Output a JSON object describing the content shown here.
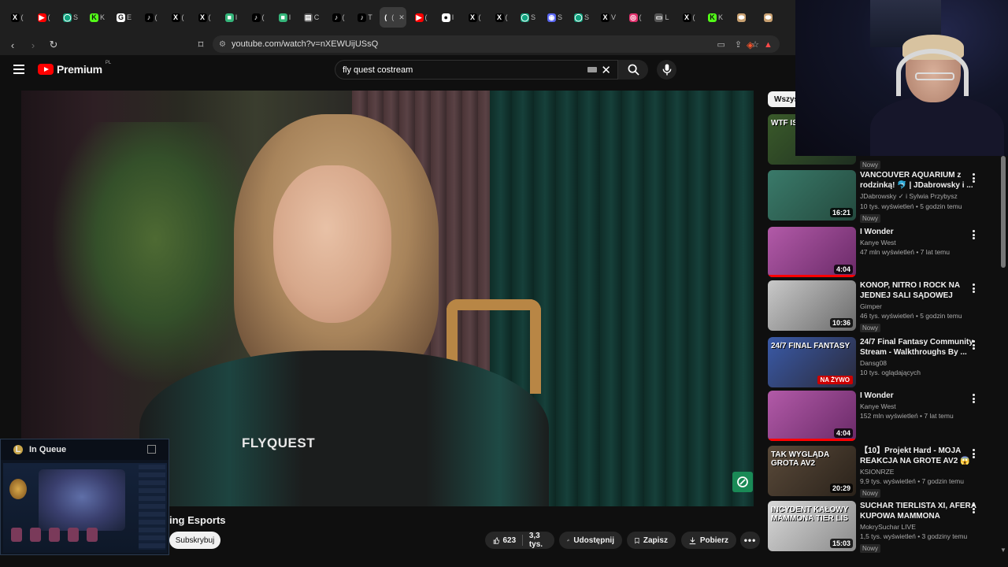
{
  "browser": {
    "tabs": [
      {
        "icon": "x-icon",
        "label": "(",
        "color": "#000000",
        "glyph": "X"
      },
      {
        "icon": "youtube-icon",
        "label": "(",
        "color": "#ff0000",
        "glyph": "▶"
      },
      {
        "icon": "circle-logo-icon",
        "label": "S",
        "color": "#10a37f",
        "glyph": "◯"
      },
      {
        "icon": "kick-icon",
        "label": "K",
        "color": "#53fc18",
        "glyph": "K"
      },
      {
        "icon": "google-icon",
        "label": "E",
        "color": "#ffffff",
        "glyph": "G"
      },
      {
        "icon": "tiktok-icon",
        "label": "(",
        "color": "#000000",
        "glyph": "♪"
      },
      {
        "icon": "x-icon",
        "label": "(",
        "color": "#000000",
        "glyph": "X"
      },
      {
        "icon": "x-icon",
        "label": "(",
        "color": "#000000",
        "glyph": "X"
      },
      {
        "icon": "app-icon",
        "label": "I",
        "color": "#35b57a",
        "glyph": "■"
      },
      {
        "icon": "tiktok-icon",
        "label": "(",
        "color": "#000000",
        "glyph": "♪"
      },
      {
        "icon": "app-icon",
        "label": "I",
        "color": "#35b57a",
        "glyph": "■"
      },
      {
        "icon": "doc-icon",
        "label": "C",
        "color": "#555555",
        "glyph": "▤"
      },
      {
        "icon": "tiktok-icon",
        "label": "(",
        "color": "#000000",
        "glyph": "♪"
      },
      {
        "icon": "tiktok-icon",
        "label": "T",
        "color": "#000000",
        "glyph": "♪"
      },
      {
        "icon": "generic-icon",
        "label": "(",
        "color": "#3c3c3c",
        "glyph": "(",
        "active": true
      },
      {
        "icon": "youtube-icon",
        "label": "(",
        "color": "#ff0000",
        "glyph": "▶"
      },
      {
        "icon": "github-icon",
        "label": "I",
        "color": "#ffffff",
        "glyph": "●"
      },
      {
        "icon": "x-icon",
        "label": "(",
        "color": "#000000",
        "glyph": "X"
      },
      {
        "icon": "x-icon",
        "label": "(",
        "color": "#000000",
        "glyph": "X"
      },
      {
        "icon": "circle-logo-icon",
        "label": "S",
        "color": "#10a37f",
        "glyph": "◯"
      },
      {
        "icon": "discord-icon",
        "label": "S",
        "color": "#5865f2",
        "glyph": "◉"
      },
      {
        "icon": "circle-logo-icon",
        "label": "S",
        "color": "#10a37f",
        "glyph": "◯"
      },
      {
        "icon": "x-icon",
        "label": "V",
        "color": "#000000",
        "glyph": "X"
      },
      {
        "icon": "instagram-icon",
        "label": "(",
        "color": "#e1306c",
        "glyph": "◎"
      },
      {
        "icon": "monitor-icon",
        "label": "L",
        "color": "#555555",
        "glyph": "▭"
      },
      {
        "icon": "x-icon",
        "label": "(",
        "color": "#000000",
        "glyph": "X"
      },
      {
        "icon": "kick-icon",
        "label": "K",
        "color": "#53fc18",
        "glyph": "K"
      },
      {
        "icon": "pill-icon",
        "label": "",
        "color": "#c8a070",
        "glyph": "⬬"
      },
      {
        "icon": "pill-icon",
        "label": "",
        "color": "#c8a070",
        "glyph": "⬬"
      }
    ],
    "close_glyph": "✕",
    "url": "youtube.com/watch?v=nXEWUijUSsQ"
  },
  "youtube": {
    "logo_text": "Premium",
    "logo_region": "PL",
    "search_value": "fly quest costream",
    "video": {
      "jacket_brand": "FLYQUEST",
      "channel_partial": "ing Esports",
      "subscribe_label": "Subskrybuj",
      "likes": "623",
      "dislikes": "3,3 tys.",
      "share_label": "Udostępnij",
      "save_label": "Zapisz",
      "download_label": "Pobierz"
    },
    "filter_chip": "Wszys",
    "related": [
      {
        "title": "",
        "channel": "",
        "stats": "",
        "badge": "Nowy",
        "duration": "",
        "thumb_colors": [
          "#3a5a2a",
          "#1e2e20"
        ],
        "thumb_text": "WTF IS THIS?!"
      },
      {
        "title": "VANCOUVER AQUARIUM z rodzinką! 🐬 | JDabrowsky i ...",
        "channel": "JDabrowsky ✓ i Sylwia Przybysz",
        "stats": "10 tys. wyświetleń • 5 godzin temu",
        "badge": "Nowy",
        "duration": "16:21",
        "thumb_colors": [
          "#3a7a6a",
          "#244a3e"
        ],
        "thumb_text": ""
      },
      {
        "title": "I Wonder",
        "channel": "Kanye West",
        "stats": "47 mln wyświetleń • 7 lat temu",
        "badge": "",
        "duration": "4:04",
        "thumb_colors": [
          "#b25aa8",
          "#6a2a68"
        ],
        "thumb_text": "",
        "progress": 1
      },
      {
        "title": "KONOP, NITRO I ROCK NA JEDNEJ SALI SĄDOWEJ",
        "channel": "Gimper",
        "stats": "46 tys. wyświetleń • 5 godzin temu",
        "badge": "Nowy",
        "duration": "10:36",
        "thumb_colors": [
          "#c9c9c9",
          "#6a6a6a"
        ],
        "thumb_text": ""
      },
      {
        "title": "24/7 Final Fantasy Community Stream - Walkthroughs By ...",
        "channel": "Dansg08",
        "stats": "10 tys. oglądających",
        "badge": "",
        "duration": "",
        "live": "NA ŻYWO",
        "thumb_colors": [
          "#3a5aa8",
          "#2a2a3a"
        ],
        "thumb_text": "24/7 FINAL FANTASY"
      },
      {
        "title": "I Wonder",
        "channel": "Kanye West",
        "stats": "152 mln wyświetleń • 7 lat temu",
        "badge": "",
        "duration": "4:04",
        "thumb_colors": [
          "#b25aa8",
          "#6a2a68"
        ],
        "thumb_text": "",
        "progress": 1
      },
      {
        "title": "【10】Projekt Hard - MOJA REAKCJA NA GROTE AV2 😱 ...",
        "channel": "KSIONRZE",
        "stats": "9,9 tys. wyświetleń • 7 godzin temu",
        "badge": "Nowy",
        "duration": "20:29",
        "thumb_colors": [
          "#5a4a3a",
          "#2a221a"
        ],
        "thumb_text": "TAK WYGLĄDA GROTA AV2"
      },
      {
        "title": "SUCHAR TIERLISTA XI, AFERA KUPOWA MAMMONA",
        "channel": "MokrySuchar LIVE",
        "stats": "1,5 tys. wyświetleń • 3 godziny temu",
        "badge": "Nowy",
        "duration": "15:03",
        "thumb_colors": [
          "#d8d8d8",
          "#8a8a8a"
        ],
        "thumb_text": "INCYDENT KAŁOWY MAMMONA TIER LIS"
      }
    ]
  },
  "overlay": {
    "client_title": "In Queue"
  }
}
